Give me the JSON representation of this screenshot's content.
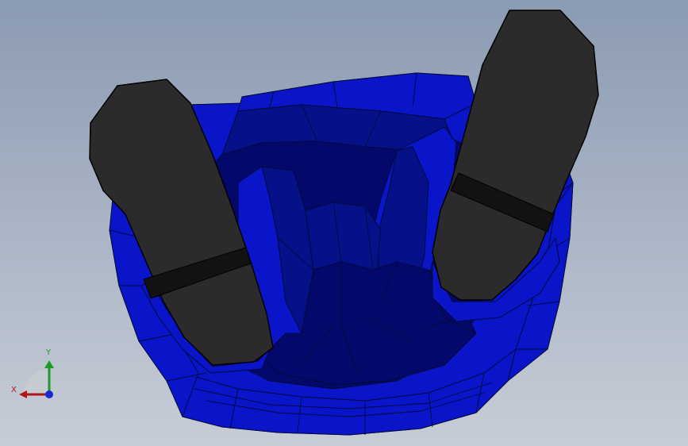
{
  "viewport": {
    "background_top": "#8b9bb2",
    "background_bottom": "#c7cdd7"
  },
  "model": {
    "body_color": "#0a14c8",
    "body_shade_color": "#061088",
    "body_dark_color": "#04086a",
    "edge_color": "#000a3a",
    "pad_color": "#2b2b2b",
    "pad_band_color": "#121212",
    "pad_highlight_color": "#d0d2d8"
  },
  "triad": {
    "x_label": "X",
    "y_label": "Y",
    "x_color": "#b01515",
    "y_color": "#1f9a2a",
    "z_color": "#1a28d0"
  }
}
